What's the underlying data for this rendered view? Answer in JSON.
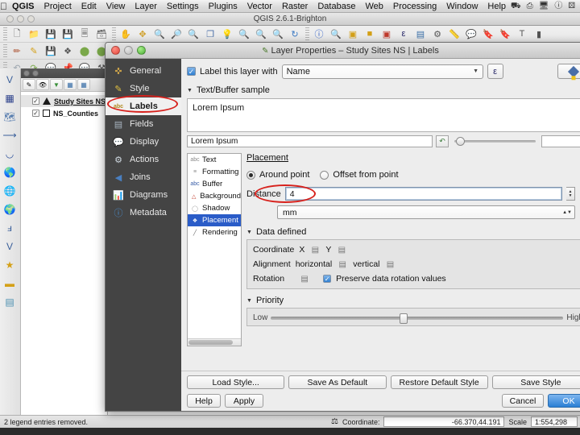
{
  "menubar": {
    "apple": "apple-logo",
    "items": [
      "QGIS",
      "Project",
      "Edit",
      "View",
      "Layer",
      "Settings",
      "Plugins",
      "Vector",
      "Raster",
      "Database",
      "Web",
      "Processing",
      "Window",
      "Help"
    ],
    "status_icons": [
      "dropbox-icon",
      "sync-icon",
      "display-icon",
      "clock-icon",
      "bluetooth-icon",
      "wifi-icon",
      "volume-icon"
    ]
  },
  "app_window": {
    "title": "QGIS 2.6.1-Brighton",
    "toolbar_row1": [
      "new-file-icon",
      "open-folder-icon",
      "save-icon",
      "save-as-icon",
      "new-print-composer-icon",
      "composer-manager-icon"
    ],
    "toolbar_row2": [
      "pan-map-icon",
      "pan-selection-icon",
      "zoom-in-icon",
      "zoom-out-icon",
      "zoom-full-icon",
      "zoom-selection-icon",
      "zoom-layer-icon",
      "zoom-native-icon",
      "zoom-last-icon",
      "zoom-next-icon",
      "refresh-icon",
      "identify-icon",
      "select-features-icon",
      "select-radius-icon",
      "deselect-icon",
      "open-table-icon",
      "field-calculator-icon",
      "measure-icon",
      "map-tips-icon",
      "new-bookmark-icon",
      "show-bookmarks-icon",
      "text-annotation-icon"
    ],
    "toolbar_row3": [
      "undo-icon",
      "redo-icon",
      "add-feature-icon",
      "node-tool-icon",
      "delete-icon",
      "cut-icon"
    ]
  },
  "left_toolbar": {
    "icons": [
      "add-vector-layer-icon",
      "add-raster-layer-icon",
      "add-mesh-layer-icon",
      "add-spatialite-layer-icon",
      "add-postgis-layer-icon",
      "add-wms-layer-icon",
      "add-wcs-layer-icon",
      "add-wfs-layer-icon",
      "add-delimited-text-icon",
      "new-vector-layer-icon",
      "new-shapefile-icon",
      "new-memory-layer-icon",
      "open-table-icon"
    ]
  },
  "layers_panel": {
    "toolbar_icons": [
      "style-manager-icon",
      "filter-legend-icon",
      "filter-legend-expression-icon",
      "expand-all-icon",
      "collapse-all-icon",
      "remove-layer-icon"
    ],
    "layers": [
      {
        "name": "Study Sites NS",
        "checked": true,
        "symbol": "triangle-symbol",
        "selected": true
      },
      {
        "name": "NS_Counties",
        "checked": true,
        "symbol": "square-symbol",
        "selected": false
      }
    ]
  },
  "statusbar": {
    "message": "2 legend entries removed.",
    "render_icon": "render-icon",
    "coordinate_label": "Coordinate:",
    "coordinate_value": "-66.370,44.191",
    "scale_label": "Scale",
    "scale_value": "1:554,298"
  },
  "dialog": {
    "title": "Layer Properties – Study Sites NS | Labels",
    "title_icon": "qgis-label-icon",
    "window_buttons": [
      "close-button",
      "minimize-button",
      "zoom-button"
    ],
    "sidebar": [
      {
        "label": "General",
        "icon": "general-icon",
        "active": false
      },
      {
        "label": "Style",
        "icon": "style-icon",
        "active": false
      },
      {
        "label": "Labels",
        "icon": "labels-abc-icon",
        "active": true
      },
      {
        "label": "Fields",
        "icon": "fields-table-icon",
        "active": false
      },
      {
        "label": "Display",
        "icon": "display-balloon-icon",
        "active": false
      },
      {
        "label": "Actions",
        "icon": "actions-gear-icon",
        "active": false
      },
      {
        "label": "Joins",
        "icon": "joins-arrow-icon",
        "active": false
      },
      {
        "label": "Diagrams",
        "icon": "diagrams-chart-icon",
        "active": false
      },
      {
        "label": "Metadata",
        "icon": "metadata-info-icon",
        "active": false
      }
    ],
    "annotations": [
      {
        "name": "labels-sidebar-highlight",
        "shape": "red-ellipse",
        "color": "#d7211c"
      },
      {
        "name": "distance-field-highlight",
        "shape": "red-ellipse",
        "color": "#d7211c"
      }
    ],
    "label_layer_checkbox": {
      "checked": true,
      "label": "Label this layer with"
    },
    "label_field_value": "Name",
    "expression_button": "epsilon-expression-icon",
    "style_button_icon": "style-dock-icon",
    "text_buffer_section": {
      "title": "Text/Buffer sample",
      "expanded": true,
      "sample_text": "Lorem Ipsum",
      "sample_input_value": "Lorem Ipsum",
      "revert_icon": "revert-arrow-icon"
    },
    "inner_tabs": [
      {
        "label": "Text",
        "icon": "text-abc-icon",
        "selected": false
      },
      {
        "label": "Formatting",
        "icon": "formatting-icon",
        "selected": false
      },
      {
        "label": "Buffer",
        "icon": "buffer-abc-icon",
        "selected": false
      },
      {
        "label": "Background",
        "icon": "background-shield-icon",
        "selected": false
      },
      {
        "label": "Shadow",
        "icon": "shadow-icon",
        "selected": false
      },
      {
        "label": "Placement",
        "icon": "placement-icon",
        "selected": true
      },
      {
        "label": "Rendering",
        "icon": "rendering-pen-icon",
        "selected": false
      }
    ],
    "placement": {
      "heading": "Placement",
      "modes": [
        {
          "label": "Around point",
          "selected": true
        },
        {
          "label": "Offset from point",
          "selected": false
        }
      ],
      "distance_label": "Distance",
      "distance_value": "4",
      "units_value": "mm",
      "data_defined_icon": "data-defined-icon"
    },
    "data_defined": {
      "title": "Data defined",
      "expanded": true,
      "coordinate_label": "Coordinate",
      "coordinate_x_label": "X",
      "coordinate_y_label": "Y",
      "alignment_label": "Alignment",
      "alignment_h_label": "horizontal",
      "alignment_v_label": "vertical",
      "rotation_label": "Rotation",
      "preserve_rotation_label": "Preserve data rotation values",
      "preserve_rotation_checked": true
    },
    "priority": {
      "title": "Priority",
      "expanded": true,
      "low_label": "Low",
      "high_label": "High",
      "value_percent": 44
    },
    "footer": {
      "style_buttons": [
        "Load Style...",
        "Save As Default",
        "Restore Default Style",
        "Save Style"
      ],
      "help": "Help",
      "apply": "Apply",
      "cancel": "Cancel",
      "ok": "OK"
    }
  }
}
